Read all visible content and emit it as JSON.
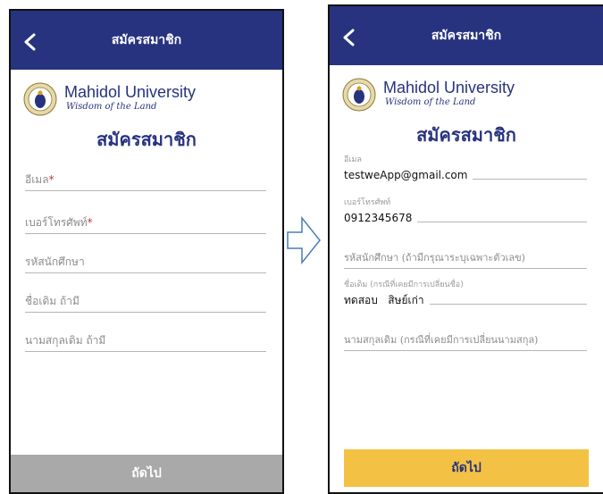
{
  "left_screen": {
    "header_title": "สมัครสมาชิก",
    "logo_name": "Mahidol University",
    "logo_motto": "Wisdom of the Land",
    "form_title": "สมัครสมาชิก",
    "fields": {
      "email_placeholder": "อีเมล",
      "required_mark": "*",
      "phone_placeholder": "เบอร์โทรศัพท์",
      "student_id_placeholder": "รหัสนักศึกษา",
      "old_first_name_placeholder": "ชื่อเดิม ถ้ามี",
      "old_last_name_placeholder": "นามสกุลเดิม ถ้ามี"
    },
    "next_button": "ถัดไป",
    "next_button_color": "#a9a9a9"
  },
  "right_screen": {
    "header_title": "สมัครสมาชิก",
    "logo_name": "Mahidol University",
    "logo_motto": "Wisdom of the Land",
    "form_title": "สมัครสมาชิก",
    "fields": {
      "email_label": "อีเมล",
      "email_value": "testweApp@gmail.com",
      "phone_label": "เบอร์โทรศัพท์",
      "phone_value": "0912345678",
      "student_id_placeholder": "รหัสนักศึกษา (ถ้ามีกรุณาระบุเฉพาะตัวเลข)",
      "old_first_name_label": "ชื่อเดิม (กรณีที่เคยมีการเปลี่ยนชื่อ)",
      "old_first_name_value": "ทดสอบ   สิษย์เก่า",
      "old_last_name_placeholder": "นามสกุลเดิม (กรณีที่เคยมีการเปลี่ยนนามสกุล)"
    },
    "next_button": "ถัดไป",
    "next_button_color": "#f3c244"
  },
  "colors": {
    "header": "#27337e",
    "brand_text": "#27337e"
  },
  "icons": [
    "back-chevron-icon",
    "mahidol-seal-logo",
    "right-arrow-icon"
  ]
}
